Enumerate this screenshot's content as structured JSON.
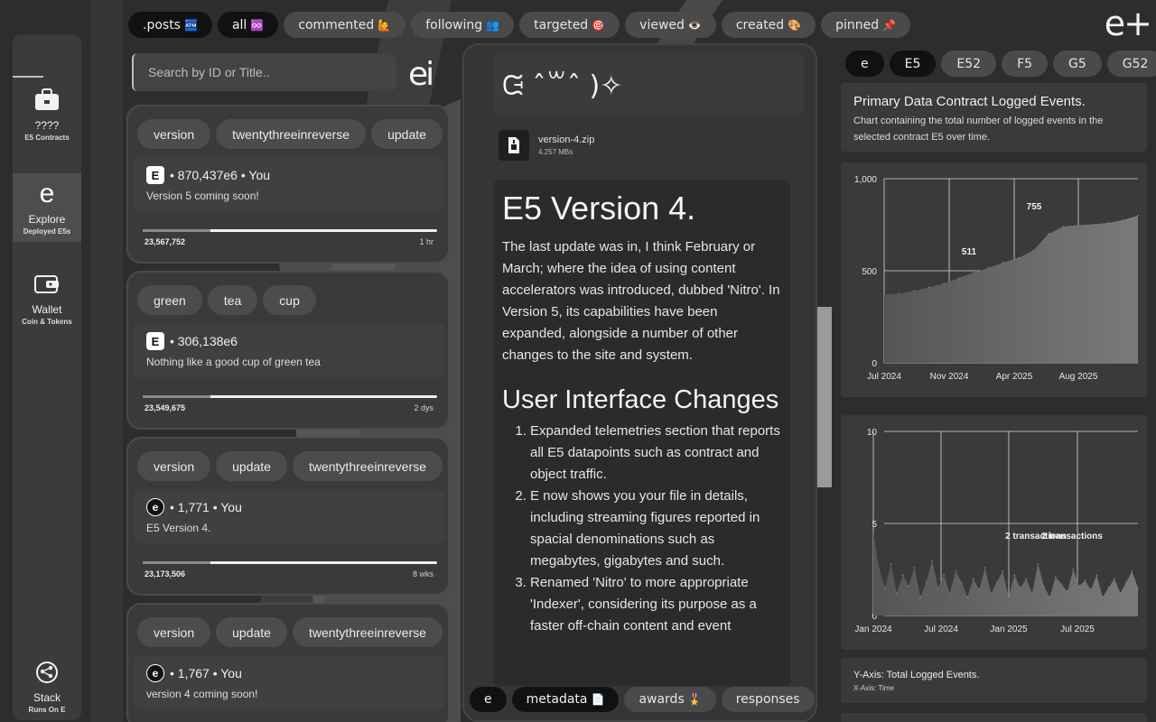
{
  "top_tabs": [
    {
      "label": ".posts",
      "emoji": "🏧",
      "dark": true
    },
    {
      "label": "all",
      "emoji": "♾️",
      "dark": true
    },
    {
      "label": "commented",
      "emoji": "🙋",
      "dark": false
    },
    {
      "label": "following",
      "emoji": "👥",
      "dark": false
    },
    {
      "label": "targeted",
      "emoji": "🎯",
      "dark": false
    },
    {
      "label": "viewed",
      "emoji": "👁️",
      "dark": false
    },
    {
      "label": "created",
      "emoji": "🎨",
      "dark": false
    },
    {
      "label": "pinned",
      "emoji": "📌",
      "dark": false
    }
  ],
  "brand": {
    "corner_logo": "e+",
    "feed_logo": "ei"
  },
  "sidebar": {
    "items": [
      {
        "icon": "briefcase-icon",
        "label": "????",
        "sub": "E5 Contracts",
        "active": false
      },
      {
        "icon": "e-logo-icon",
        "glyph": "e",
        "label": "Explore",
        "sub": "Deployed E5s",
        "active": true
      },
      {
        "icon": "wallet-icon",
        "label": "Wallet",
        "sub": "Coin & Tokens",
        "active": false
      },
      {
        "icon": "stack-icon",
        "label": "Stack",
        "sub": "Runs On E",
        "active": false
      }
    ]
  },
  "search": {
    "placeholder": "Search by ID or Title.."
  },
  "posts": [
    {
      "tags": [
        "version",
        "twentythreeinreverse",
        "update"
      ],
      "badge": "E",
      "badge_style": "square",
      "meta": "• 870,437e6 • You",
      "text": "Version 5 coming soon!",
      "count": "23,567,752",
      "time": "1 hr",
      "progress": 0.23
    },
    {
      "tags": [
        "green",
        "tea",
        "cup"
      ],
      "badge": "E",
      "badge_style": "square",
      "meta": "• 306,138e6",
      "text": "Nothing like a good cup of green tea",
      "count": "23,549,675",
      "time": "2 dys",
      "progress": 0.23
    },
    {
      "tags": [
        "version",
        "update",
        "twentythreeinreverse"
      ],
      "badge": "e",
      "badge_style": "round",
      "meta": "• 1,771 • You",
      "text": "E5 Version 4.",
      "count": "23,173,506",
      "time": "8 wks",
      "progress": 0.23
    },
    {
      "tags": [
        "version",
        "update",
        "twentythreeinreverse"
      ],
      "badge": "e",
      "badge_style": "round",
      "meta": "• 1,767 • You",
      "text": "version 4 coming soon!",
      "count": "",
      "time": "",
      "progress": 0
    }
  ],
  "detail": {
    "kaomoji": "ᙍ ˆ꒳ˆ )✧",
    "file": {
      "name": "version-4.zip",
      "size": "4.257 MBs"
    },
    "title": "E5 Version 4.",
    "intro": "The last update was in, I think February or March; where the idea of using content accelerators was introduced, dubbed 'Nitro'. In Version 5, its capabilities have been expanded, alongside a number of other changes to the site and system.",
    "section_title": "User Interface Changes",
    "list": [
      "Expanded telemetries section that reports all E5 datapoints such as contract and object traffic.",
      "E now shows you your file in details, including streaming figures reported in spacial denominations such as megabytes, gigabytes and such.",
      "Renamed 'Nitro' to more appropriate 'Indexer', considering its purpose as a faster off-chain content and event"
    ]
  },
  "bottom_tabs": [
    {
      "label": "e",
      "emoji": "",
      "dark": true
    },
    {
      "label": "metadata",
      "emoji": "📄",
      "dark": true
    },
    {
      "label": "awards",
      "emoji": "🎖️",
      "dark": false
    },
    {
      "label": "responses",
      "emoji": "",
      "dark": false
    }
  ],
  "contract_tabs": [
    {
      "label": "e",
      "dark": true
    },
    {
      "label": "E5",
      "dark": true
    },
    {
      "label": "E52",
      "dark": false
    },
    {
      "label": "F5",
      "dark": false
    },
    {
      "label": "G5",
      "dark": false
    },
    {
      "label": "G52",
      "dark": false
    }
  ],
  "info": {
    "title": "Primary Data Contract Logged Events.",
    "description": "Chart containing the total number of logged events in the selected contract E5 over time."
  },
  "axis_info": {
    "y": "Y-Axis: Total Logged Events.",
    "x": "X-Axis: Time"
  },
  "chart_data": [
    {
      "type": "area",
      "title": "",
      "ylim": [
        0,
        1000
      ],
      "y_ticks": [
        "0",
        "500",
        "1,000"
      ],
      "x_ticks": [
        "Jul 2024",
        "Nov 2024",
        "Apr 2025",
        "Aug 2025"
      ],
      "annotations": [
        {
          "label": "511",
          "x": "Nov 2024",
          "y": 511
        },
        {
          "label": "755",
          "x": "Apr 2025",
          "y": 755
        }
      ],
      "x": [
        "Jun 2024",
        "Jul 2024",
        "Aug 2024",
        "Sep 2024",
        "Oct 2024",
        "Nov 2024",
        "Dec 2024",
        "Jan 2025",
        "Feb 2025",
        "Mar 2025",
        "Apr 2025",
        "May 2025",
        "Jun 2025",
        "Jul 2025",
        "Aug 2025",
        "Sep 2025",
        "Oct 2025",
        "Nov 2025"
      ],
      "values": [
        370,
        375,
        390,
        410,
        430,
        460,
        490,
        515,
        545,
        570,
        610,
        700,
        740,
        748,
        752,
        760,
        775,
        800
      ],
      "grid": true,
      "color": "#6e6e6e"
    },
    {
      "type": "area",
      "title": "",
      "ylim": [
        0,
        10
      ],
      "y_ticks": [
        "0",
        "5",
        "10"
      ],
      "x_ticks": [
        "Jan 2024",
        "Jul 2024",
        "Jan 2025",
        "Jul 2025"
      ],
      "annotations": [
        {
          "label": "2 transactions",
          "x": "Jan 2025",
          "y": 2
        },
        {
          "label": "2 transactions",
          "x": "Apr 2025",
          "y": 2
        }
      ],
      "values": [
        4.5,
        2.5,
        1.5,
        2.8,
        1.2,
        2.2,
        1.6,
        2.6,
        1.0,
        1.8,
        3.0,
        1.5,
        2.2,
        1.2,
        2.4,
        1.8,
        1.0,
        2.0,
        1.4,
        2.6,
        1.2,
        1.8,
        2.4,
        1.0,
        2.2,
        1.5,
        2.0,
        1.2,
        2.8,
        1.6,
        1.0,
        2.1,
        1.7,
        1.3,
        2.5,
        1.6,
        1.9,
        1.4,
        2.2,
        1.0,
        1.5,
        2.0,
        1.2,
        1.8,
        2.4,
        1.5
      ],
      "grid": true,
      "color": "#6e6e6e"
    }
  ]
}
